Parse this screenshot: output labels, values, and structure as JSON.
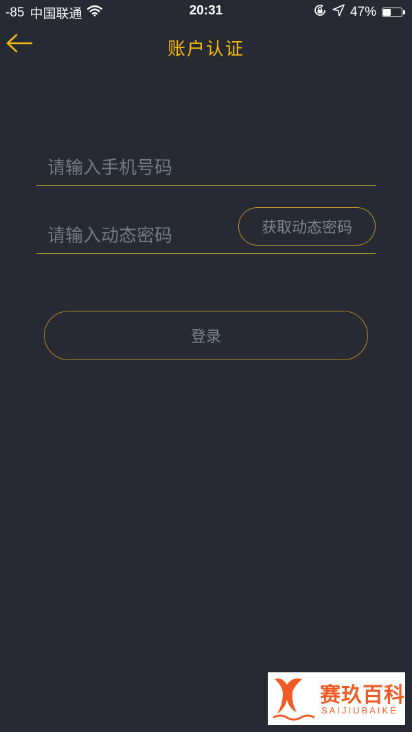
{
  "status_bar": {
    "signal": "-85",
    "carrier": "中国联通",
    "time": "20:31",
    "battery": "47%",
    "battery_level": 0.47
  },
  "nav": {
    "title": "账户认证",
    "accent_color": "#f4b90f"
  },
  "form": {
    "phone_placeholder": "请输入手机号码",
    "phone_value": "",
    "code_placeholder": "请输入动态密码",
    "code_value": "",
    "get_code_label": "获取动态密码",
    "login_label": "登录"
  },
  "watermark": {
    "name": "赛玖百科",
    "subtitle": "SAIJIUBAIKE"
  },
  "icons": [
    "back-arrow-icon",
    "wifi-icon",
    "orientation-lock-icon",
    "location-arrow-icon",
    "battery-icon",
    "watermark-logo-icon"
  ]
}
